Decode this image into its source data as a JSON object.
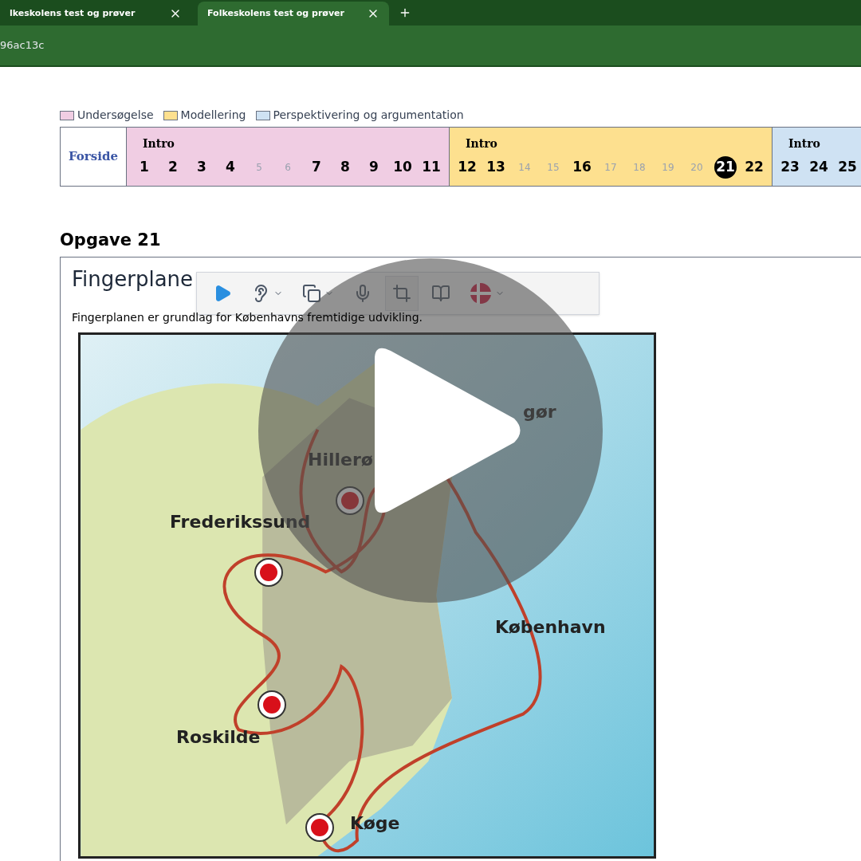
{
  "browser": {
    "tabs": [
      {
        "title": "lkeskolens test og prøver",
        "selected": false
      },
      {
        "title": "Folkeskolens test og prøver",
        "selected": true
      }
    ],
    "address": "96ac13c"
  },
  "legend": [
    {
      "label": "Undersøgelse",
      "color": "#f0cde3"
    },
    {
      "label": "Modellering",
      "color": "#fde08f"
    },
    {
      "label": "Perspektivering og argumentation",
      "color": "#cfe2f3"
    }
  ],
  "nav": {
    "home": "Forside",
    "groups": [
      {
        "intro": "Intro",
        "color": "#f0cde3",
        "items": [
          {
            "n": "1",
            "available": true,
            "selected": false
          },
          {
            "n": "2",
            "available": true,
            "selected": false
          },
          {
            "n": "3",
            "available": true,
            "selected": false
          },
          {
            "n": "4",
            "available": true,
            "selected": false
          },
          {
            "n": "5",
            "available": false,
            "selected": false
          },
          {
            "n": "6",
            "available": false,
            "selected": false
          },
          {
            "n": "7",
            "available": true,
            "selected": false
          },
          {
            "n": "8",
            "available": true,
            "selected": false
          },
          {
            "n": "9",
            "available": true,
            "selected": false
          },
          {
            "n": "10",
            "available": true,
            "selected": false
          },
          {
            "n": "11",
            "available": true,
            "selected": false
          }
        ]
      },
      {
        "intro": "Intro",
        "color": "#fde08f",
        "items": [
          {
            "n": "12",
            "available": true,
            "selected": false
          },
          {
            "n": "13",
            "available": true,
            "selected": false
          },
          {
            "n": "14",
            "available": false,
            "selected": false
          },
          {
            "n": "15",
            "available": false,
            "selected": false
          },
          {
            "n": "16",
            "available": true,
            "selected": false
          },
          {
            "n": "17",
            "available": false,
            "selected": false
          },
          {
            "n": "18",
            "available": false,
            "selected": false
          },
          {
            "n": "19",
            "available": false,
            "selected": false
          },
          {
            "n": "20",
            "available": false,
            "selected": false
          },
          {
            "n": "21",
            "available": true,
            "selected": true
          },
          {
            "n": "22",
            "available": true,
            "selected": false
          }
        ]
      },
      {
        "intro": "Intro",
        "color": "#cfe2f3",
        "items": [
          {
            "n": "23",
            "available": true,
            "selected": false
          },
          {
            "n": "24",
            "available": true,
            "selected": false
          },
          {
            "n": "25",
            "available": true,
            "selected": false
          }
        ]
      }
    ]
  },
  "task": {
    "heading": "Opgave 21",
    "title": "Fingerplane",
    "text": "Fingerplanen er grundlag for Københavns fremtidige udvikling.",
    "map_labels": [
      "gør",
      "Hillerø",
      "Frederikssund",
      "København",
      "Roskilde",
      "Køge"
    ]
  },
  "toolbar": [
    {
      "kind": "play",
      "caret": false,
      "selected": false
    },
    {
      "kind": "listen",
      "caret": true,
      "selected": false
    },
    {
      "kind": "copy",
      "caret": true,
      "selected": false
    },
    {
      "kind": "dictate",
      "caret": false,
      "selected": false
    },
    {
      "kind": "crop",
      "caret": false,
      "selected": true
    },
    {
      "kind": "dictionary",
      "caret": false,
      "selected": false
    },
    {
      "kind": "language",
      "caret": true,
      "selected": false
    }
  ]
}
